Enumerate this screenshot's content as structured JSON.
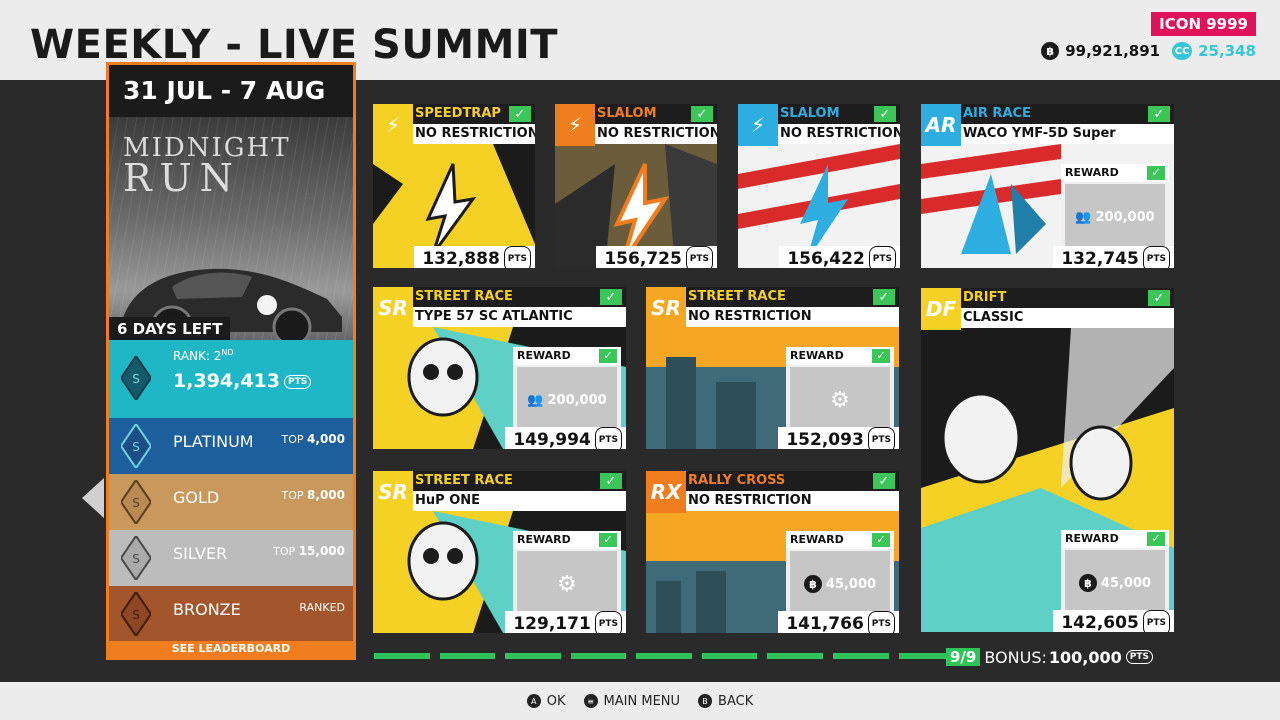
{
  "header": {
    "title": "WEEKLY - LIVE SUMMIT",
    "icon_level": "ICON 9999",
    "credits": "99,921,891",
    "crew_credits": "25,348",
    "cc_label": "CC"
  },
  "event": {
    "dates": "31 JUL - 7 AUG",
    "logo_line1": "MIDNIGHT",
    "logo_line2": "RUN",
    "days_left": "6 DAYS LEFT",
    "rank_prefix": "RANK: 2",
    "rank_suffix": "ND",
    "score": "1,394,413",
    "pts": "PTS",
    "tiers": [
      {
        "name": "PLATINUM",
        "top_label": "TOP",
        "top_value": "4,000"
      },
      {
        "name": "GOLD",
        "top_label": "TOP",
        "top_value": "8,000"
      },
      {
        "name": "SILVER",
        "top_label": "TOP",
        "top_value": "15,000"
      },
      {
        "name": "BRONZE",
        "top_label": "RANKED",
        "top_value": ""
      }
    ],
    "leaderboard_link": "SEE LEADERBOARD"
  },
  "cards": [
    {
      "badge": "",
      "type": "SPEEDTRAP",
      "sub": "NO RESTRICTION",
      "pts": "132,888",
      "type_color": "#f5d126"
    },
    {
      "badge": "",
      "type": "SLALOM",
      "sub": "NO RESTRICTION",
      "pts": "156,725",
      "type_color": "#f07d1e"
    },
    {
      "badge": "",
      "type": "SLALOM",
      "sub": "NO RESTRICTION",
      "pts": "156,422",
      "type_color": "#2eaee0"
    },
    {
      "badge": "AR",
      "type": "AIR RACE",
      "sub": "WACO YMF-5D Super",
      "pts": "132,745",
      "type_color": "#2eaee0",
      "reward": "200,000"
    },
    {
      "badge": "SR",
      "type": "STREET RACE",
      "sub": "TYPE 57 SC ATLANTIC",
      "pts": "149,994",
      "type_color": "#f5d126",
      "reward": "200,000"
    },
    {
      "badge": "SR",
      "type": "STREET RACE",
      "sub": "NO RESTRICTION",
      "pts": "152,093",
      "type_color": "#f5d126",
      "reward": ""
    },
    {
      "badge": "DF",
      "type": "DRIFT",
      "sub": "CLASSIC",
      "pts": "142,605",
      "type_color": "#f5d126",
      "reward": "45,000"
    },
    {
      "badge": "SR",
      "type": "STREET RACE",
      "sub": "HuP ONE",
      "pts": "129,171",
      "type_color": "#f5d126",
      "reward": ""
    },
    {
      "badge": "RX",
      "type": "RALLY CROSS",
      "sub": "NO RESTRICTION",
      "pts": "141,766",
      "type_color": "#f07d1e",
      "reward": "45,000"
    }
  ],
  "reward_label": "REWARD",
  "progress": {
    "completed": 9,
    "total": 9,
    "count_label": "9/9",
    "bonus_label": "BONUS:",
    "bonus_value": "100,000"
  },
  "footer": {
    "ok": "OK",
    "menu": "MAIN MENU",
    "back": "BACK"
  }
}
